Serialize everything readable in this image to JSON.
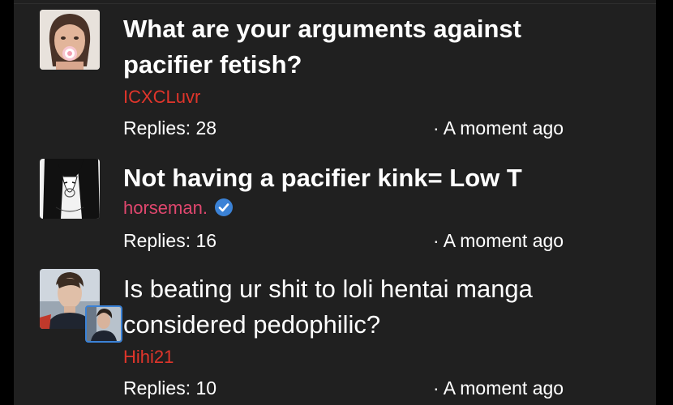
{
  "colors": {
    "background": "#202020",
    "text": "#ffffff",
    "author_red": "#e0352b",
    "author_pink": "#e0476e",
    "verified_blue": "#3b82d6"
  },
  "threads": [
    {
      "title": "What are your arguments against pacifier fetish?",
      "author": "ICXCLuvr",
      "replies": "Replies: 28",
      "time": "· A moment ago",
      "avatar_icon": "avatar-woman-pacifier"
    },
    {
      "title": "Not having a pacifier kink= Low T",
      "author": "horseman.",
      "verified": true,
      "replies": "Replies: 16",
      "time": "· A moment ago",
      "avatar_icon": "avatar-manga-girl"
    },
    {
      "title": "Is beating ur shit to loli hentai manga considered pedophilic?",
      "author": "Hihi21",
      "replies": "Replies: 10",
      "time": "· A moment ago",
      "avatar_icon": "avatar-man-portrait"
    }
  ]
}
